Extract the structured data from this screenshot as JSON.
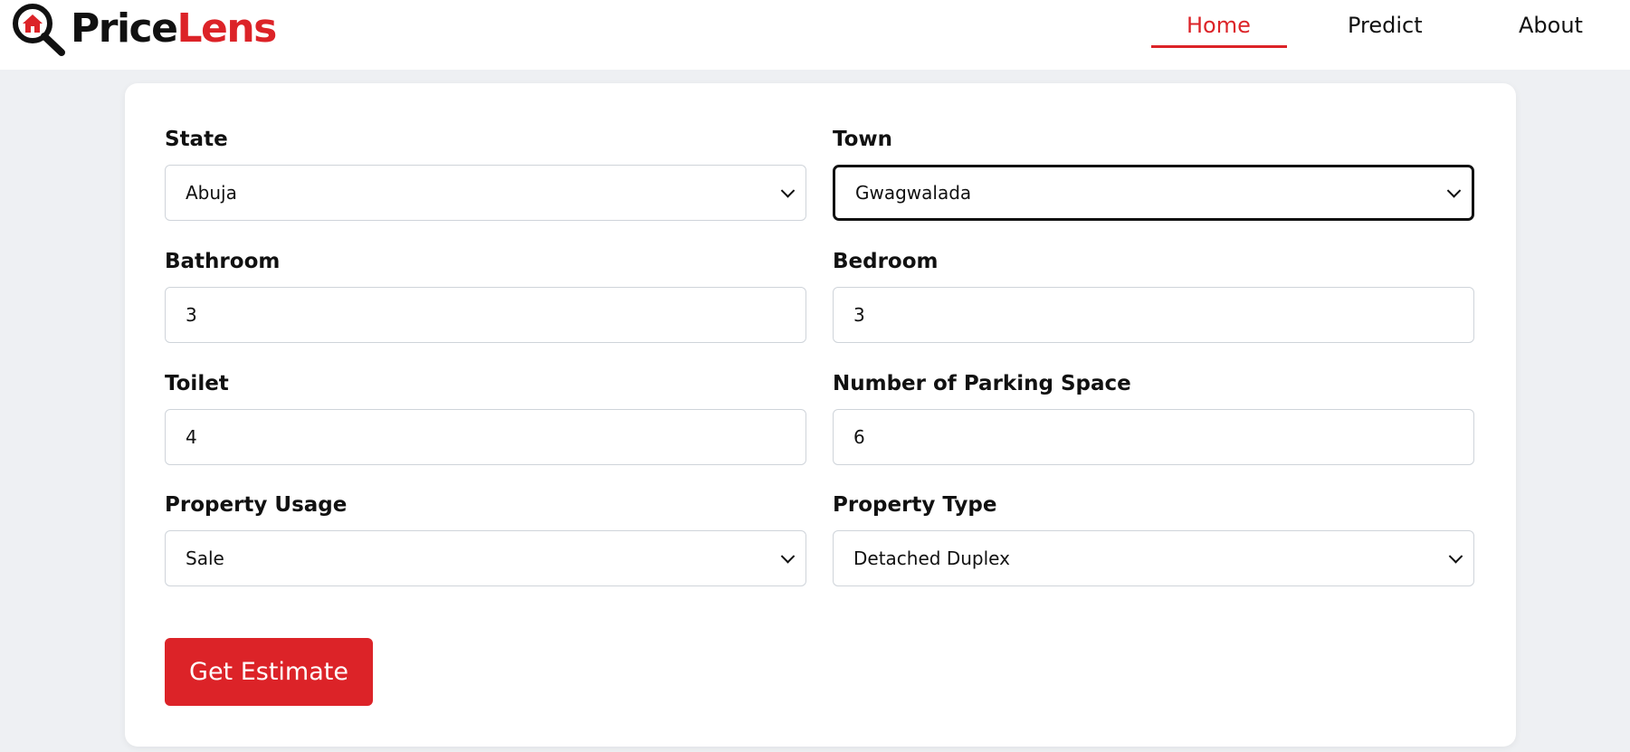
{
  "brand": {
    "part1": "Price",
    "part2": "Lens",
    "primary_color": "#dc2328",
    "icon": "magnifier-house-icon"
  },
  "nav": {
    "home": "Home",
    "predict": "Predict",
    "about": "About",
    "active": "Home"
  },
  "form": {
    "state": {
      "label": "State",
      "value": "Abuja"
    },
    "town": {
      "label": "Town",
      "value": "Gwagwalada"
    },
    "bathroom": {
      "label": "Bathroom",
      "value": "3"
    },
    "bedroom": {
      "label": "Bedroom",
      "value": "3"
    },
    "toilet": {
      "label": "Toilet",
      "value": "4"
    },
    "parking": {
      "label": "Number of Parking Space",
      "value": "6"
    },
    "usage": {
      "label": "Property Usage",
      "value": "Sale"
    },
    "type": {
      "label": "Property Type",
      "value": "Detached Duplex"
    },
    "submit_label": "Get Estimate"
  }
}
